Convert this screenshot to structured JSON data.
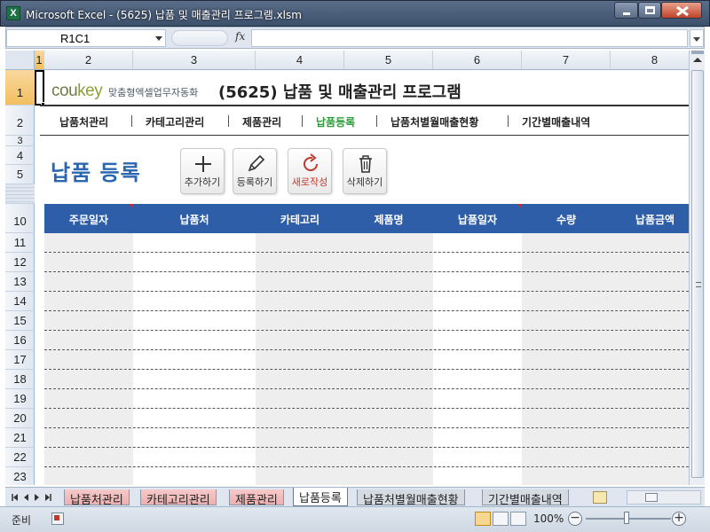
{
  "window": {
    "title": "Microsoft Excel - (5625) 납품 및 매출관리 프로그램.xlsm",
    "app_icon": "X"
  },
  "formula_bar": {
    "name_box": "R1C1",
    "fx_label": "fx",
    "formula": ""
  },
  "columns": [
    "1",
    "2",
    "3",
    "4",
    "5",
    "6",
    "7",
    "8"
  ],
  "selected_column": "1",
  "rows": [
    "1",
    "2",
    "3",
    "4",
    "5",
    "10",
    "11",
    "12",
    "13",
    "14",
    "15",
    "16",
    "17",
    "18",
    "19",
    "20",
    "21",
    "22",
    "23"
  ],
  "selected_row": "1",
  "header": {
    "logo_cou": "cou",
    "logo_key": "key",
    "logo_tagline": "맞춤형엑셀업무자동화",
    "title": "(5625) 납품 및 매출관리 프로그램"
  },
  "nav": {
    "items": [
      "납품처관리",
      "카테고리관리",
      "제품관리",
      "납품등록",
      "납품처별월매출현황",
      "기간별매출내역"
    ],
    "active": "납품등록"
  },
  "section_title": "납품 등록",
  "toolbar": {
    "add": "추가하기",
    "register": "등록하기",
    "new": "새로작성",
    "delete": "삭제하기"
  },
  "table": {
    "headers": [
      "주문일자",
      "납품처",
      "카테고리",
      "제품명",
      "납품일자",
      "수량",
      "납품금액"
    ],
    "empty_rows": 13
  },
  "sheet_tabs": {
    "items": [
      "납품처관리",
      "카테고리관리",
      "제품관리",
      "납품등록",
      "납품처별월매출현황",
      "기간별매출내역"
    ],
    "active": "납품등록"
  },
  "status_bar": {
    "mode": "준비",
    "zoom": "100%"
  },
  "colors": {
    "accent_blue": "#2e5ea8",
    "nav_active": "#2e9b3a",
    "section_title": "#2b66b1"
  }
}
